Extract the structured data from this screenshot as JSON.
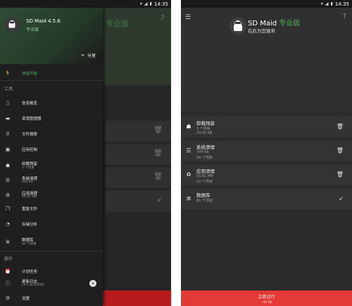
{
  "status": {
    "time": "14:35"
  },
  "left": {
    "bg": {
      "pro_label": "专业版",
      "help": "?"
    },
    "drawer": {
      "app_name": "SD Maid 4.5.6",
      "app_sub": "专业版",
      "share_label": "分享",
      "quick_start": "快速开始",
      "tools_header": "工具",
      "items": [
        {
          "label": "信息概览"
        },
        {
          "label": "资源管理器"
        },
        {
          "label": "文件搜索"
        },
        {
          "label": "应用控制"
        },
        {
          "label": "卸载残留",
          "sub": "3 个项目"
        },
        {
          "label": "系统清理",
          "sub": "344 KB"
        },
        {
          "label": "应用清理",
          "sub": "55.61 MB"
        },
        {
          "label": "重复文件"
        },
        {
          "label": "存储分析"
        },
        {
          "label": "数据库",
          "sub": "81 个项目"
        }
      ],
      "extra_header": "额外",
      "schedule_label": "计划任务",
      "changelog_label": "更新日志",
      "changelog_sub": "v4.5.6(40506)",
      "settings_label": "设置"
    }
  },
  "right": {
    "title": "SD Maid",
    "title_pro": "专业版",
    "subtitle": "在此为您服务",
    "help": "?",
    "cards": [
      {
        "title": "卸载残留",
        "line1": "3 个项目",
        "line2": "24.00 KB"
      },
      {
        "title": "系统清理",
        "line1": "344 KB",
        "line2": "59 个项目"
      },
      {
        "title": "应用清理",
        "line1": "55.61 MB",
        "line2": "10 个项目"
      },
      {
        "title": "数据库",
        "line1": "81 个项目",
        "line2": ""
      }
    ],
    "run_label": "立即运行",
    "run_sub": "~56 MB"
  },
  "colors": {
    "accent": "#4caf50",
    "run": "#e53935"
  }
}
